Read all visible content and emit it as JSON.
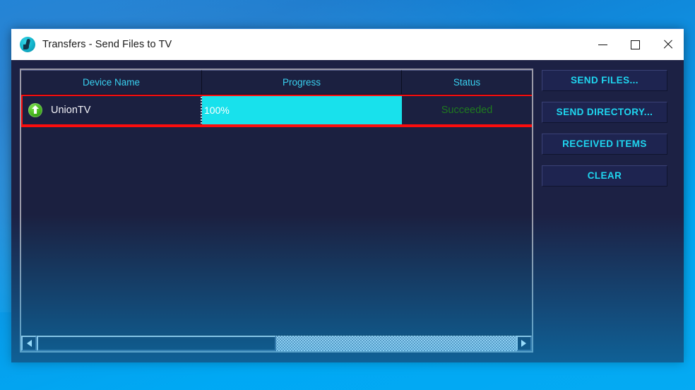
{
  "window": {
    "title": "Transfers - Send Files to TV",
    "app_icon": "app-logo-icon",
    "controls": {
      "minimize": "minimize-icon",
      "maximize": "maximize-icon",
      "close": "close-icon"
    }
  },
  "list": {
    "columns": [
      {
        "label": "Device Name"
      },
      {
        "label": "Progress"
      },
      {
        "label": "Status"
      }
    ],
    "rows": [
      {
        "icon": "upload-arrow-icon",
        "device_name": "UnionTV",
        "progress_text": "100%",
        "progress_percent": 100,
        "status": "Succeeded"
      }
    ]
  },
  "scrollbar": {
    "left_arrow": "scroll-left-icon",
    "right_arrow": "scroll-right-icon",
    "thumb_fraction": "50%"
  },
  "buttons": {
    "send_files": "SEND FILES...",
    "send_directory": "SEND DIRECTORY...",
    "received_items": "RECEIVED ITEMS",
    "clear": "CLEAR"
  },
  "colors": {
    "window_bg": "#1c2144",
    "list_bg": "#1b2040",
    "accent_cyan": "#39d0ef",
    "progress_fill": "#18e1ec",
    "status_success": "#1f7a1f",
    "annotation_red": "#fb0d0d",
    "titlebar_bg": "#ffffff",
    "desktop_blue": "#0f8fe0"
  }
}
